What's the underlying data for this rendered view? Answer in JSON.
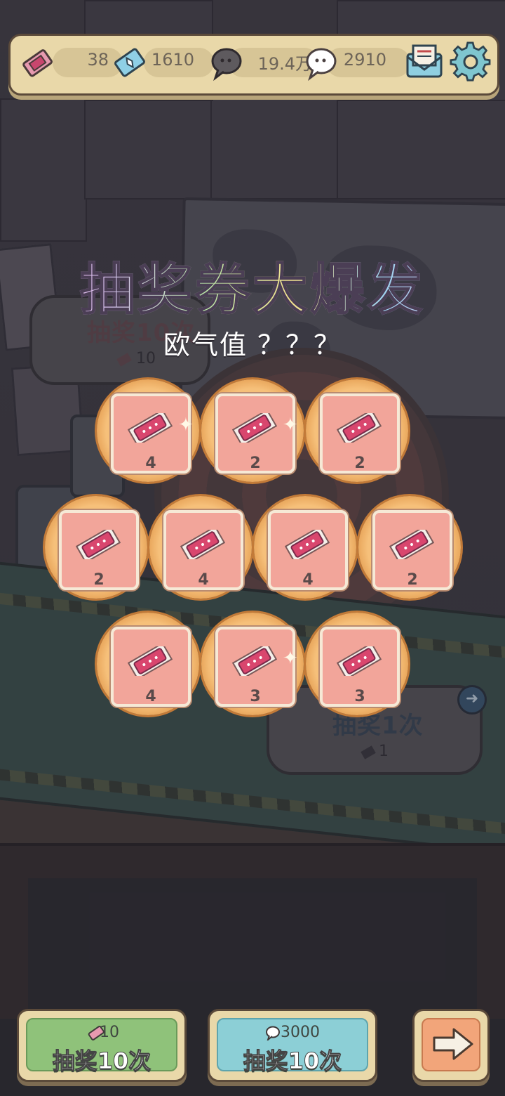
{
  "resources": {
    "tickets": "38",
    "crystals": "1610",
    "dark_speech": "19.4万",
    "speech": "2910"
  },
  "background_prompts": {
    "draw_ten_label": "抽奖10次",
    "draw_ten_cost": "10",
    "draw_one_label": "抽奖1次",
    "draw_one_cost": "1"
  },
  "headline": "抽奖券大爆发",
  "luck_label": "欧气值 ？？？",
  "rewards": [
    {
      "count": "4"
    },
    {
      "count": "2"
    },
    {
      "count": "2"
    },
    {
      "count": "2"
    },
    {
      "count": "4"
    },
    {
      "count": "4"
    },
    {
      "count": "2"
    },
    {
      "count": "4"
    },
    {
      "count": "3"
    },
    {
      "count": "3"
    }
  ],
  "buttons": {
    "ticket_draw": {
      "cost": "10",
      "label": "抽奖10次"
    },
    "speech_draw": {
      "cost": "3000",
      "label": "抽奖10次"
    }
  },
  "icons": {
    "ticket": "ticket-icon",
    "crystal": "crystal-ticket-icon",
    "dark_speech": "dark-speech-bubble-icon",
    "speech": "speech-bubble-icon",
    "mail": "mail-icon",
    "settings": "gear-icon",
    "next": "arrow-right-icon"
  },
  "colors": {
    "bar_bg": "#e9d8a9",
    "reward_orb": "#f6c07a",
    "ticket_pink": "#d9466e",
    "green_button": "#8fc27a",
    "blue_button": "#8ccfd6",
    "orange_button": "#f2a57a"
  }
}
